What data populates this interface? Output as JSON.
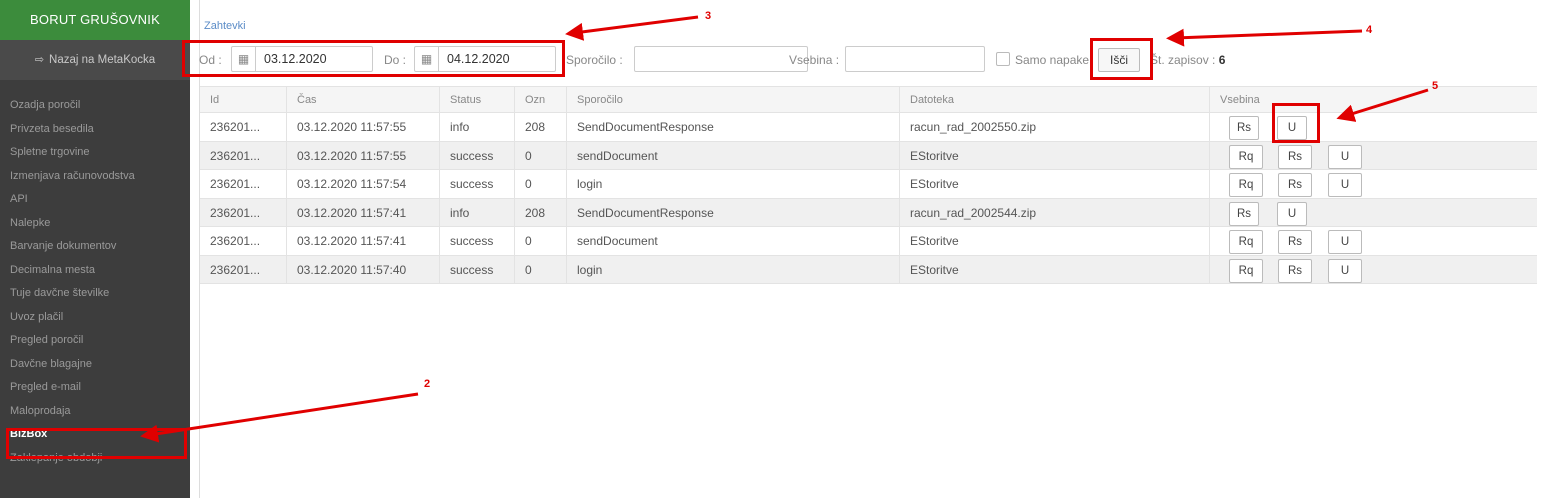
{
  "sidebar": {
    "company": "BORUT GRUŠOVNIK",
    "back_label": "Nazaj na MetaKocka",
    "items": [
      "Ozadja poročil",
      "Privzeta besedila",
      "Spletne trgovine",
      "Izmenjava računovodstva",
      "API",
      "Nalepke",
      "Barvanje dokumentov",
      "Decimalna mesta",
      "Tuje davčne številke",
      "Uvoz plačil",
      "Pregled poročil",
      "Davčne blagajne",
      "Pregled e-mail",
      "Maloprodaja",
      "BizBox",
      "Zaklepanje obdobji"
    ],
    "active_item": "BizBox"
  },
  "breadcrumb": "Zahtevki",
  "filters": {
    "from_label": "Od :",
    "from_value": "03.12.2020",
    "to_label": "Do :",
    "to_value": "04.12.2020",
    "message_label": "Sporočilo :",
    "content_label": "Vsebina :",
    "errors_only_label": "Samo napake",
    "search_button": "Išči",
    "count_label": "Št. zapisov :",
    "count_value": "6"
  },
  "table": {
    "columns": [
      "Id",
      "Čas",
      "Status",
      "Ozn",
      "Sporočilo",
      "Datoteka",
      "Vsebina"
    ],
    "rows": [
      {
        "id": "236201...",
        "time": "03.12.2020 11:57:55",
        "status": "info",
        "ozn": "208",
        "message": "SendDocumentResponse",
        "file": "racun_rad_2002550.zip",
        "buttons": [
          "Rs",
          "U"
        ]
      },
      {
        "id": "236201...",
        "time": "03.12.2020 11:57:55",
        "status": "success",
        "ozn": "0",
        "message": "sendDocument",
        "file": "EStoritve",
        "buttons": [
          "Rq",
          "Rs",
          "U"
        ]
      },
      {
        "id": "236201...",
        "time": "03.12.2020 11:57:54",
        "status": "success",
        "ozn": "0",
        "message": "login",
        "file": "EStoritve",
        "buttons": [
          "Rq",
          "Rs",
          "U"
        ]
      },
      {
        "id": "236201...",
        "time": "03.12.2020 11:57:41",
        "status": "info",
        "ozn": "208",
        "message": "SendDocumentResponse",
        "file": "racun_rad_2002544.zip",
        "buttons": [
          "Rs",
          "U"
        ]
      },
      {
        "id": "236201...",
        "time": "03.12.2020 11:57:41",
        "status": "success",
        "ozn": "0",
        "message": "sendDocument",
        "file": "EStoritve",
        "buttons": [
          "Rq",
          "Rs",
          "U"
        ]
      },
      {
        "id": "236201...",
        "time": "03.12.2020 11:57:40",
        "status": "success",
        "ozn": "0",
        "message": "login",
        "file": "EStoritve",
        "buttons": [
          "Rq",
          "Rs",
          "U"
        ]
      }
    ]
  },
  "annotations": {
    "markers": [
      "2",
      "3",
      "4",
      "5"
    ],
    "color": "#e00000"
  },
  "colors": {
    "brand": "#3c8c3c",
    "sidebar": "#3d3d3d",
    "link": "#5b8cc7"
  }
}
